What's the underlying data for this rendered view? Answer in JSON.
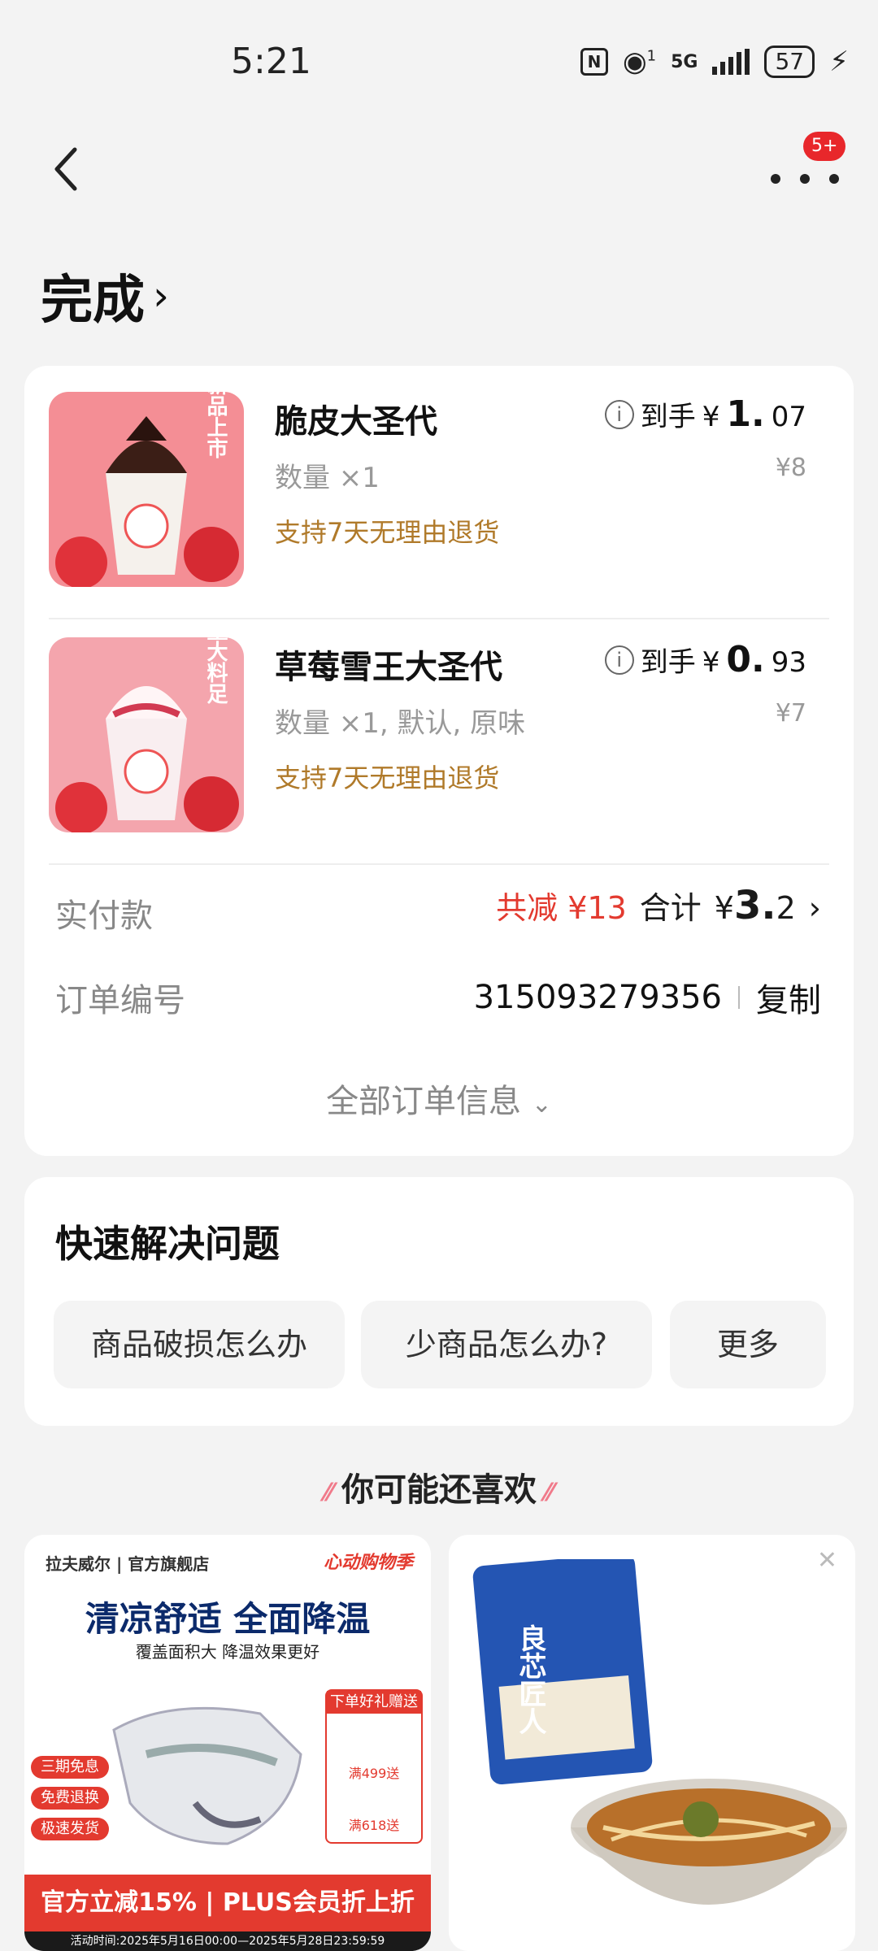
{
  "status_bar": {
    "time": "5:21",
    "network": "5G",
    "signal_sup": "1",
    "battery": "57"
  },
  "header": {
    "badge": "5+",
    "title": "完成"
  },
  "order": {
    "items": [
      {
        "name": "脆皮大圣代",
        "qty": "数量 ×1",
        "return_policy": "支持7天无理由退货",
        "final_label": "到手",
        "final_currency": "¥",
        "final_int": "1.",
        "final_dec": "07",
        "orig_price": "¥8",
        "image_tag": "新品上市"
      },
      {
        "name": "草莓雪王大圣代",
        "qty": "数量 ×1, 默认, 原味",
        "return_policy": "支持7天无理由退货",
        "final_label": "到手",
        "final_currency": "¥",
        "final_int": "0.",
        "final_dec": "93",
        "orig_price": "¥7",
        "image_tag": "量大料足"
      }
    ],
    "paid_label": "实付款",
    "discount": "共减 ¥13",
    "total_label": "合计",
    "total_currency": "¥",
    "total_int": "3.",
    "total_dec": "2",
    "order_no_label": "订单编号",
    "order_no": "315093279356",
    "copy": "复制",
    "all_info": "全部订单信息"
  },
  "help": {
    "title": "快速解决问题",
    "chips": [
      "商品破损怎么办",
      "少商品怎么办?",
      "更多"
    ]
  },
  "recommend": {
    "title": "你可能还喜欢",
    "ad": {
      "brand": "拉夫威尔 | 官方旗舰店",
      "tag": "心动购物季",
      "title": "清凉舒适 全面降温",
      "subtitle": "覆盖面积大 降温效果更好",
      "pills": [
        "三期免息",
        "免费退换",
        "极速发货"
      ],
      "gift_title": "下单好礼赠送",
      "gift_line1": "满499送",
      "gift_line2": "满618送",
      "banner": "官方立减15% | PLUS会员折上折",
      "date": "活动时间:2025年5月16日00:00—2025年5月28日23:59:59"
    },
    "product": {
      "pack_text": "良芯匠人"
    }
  }
}
